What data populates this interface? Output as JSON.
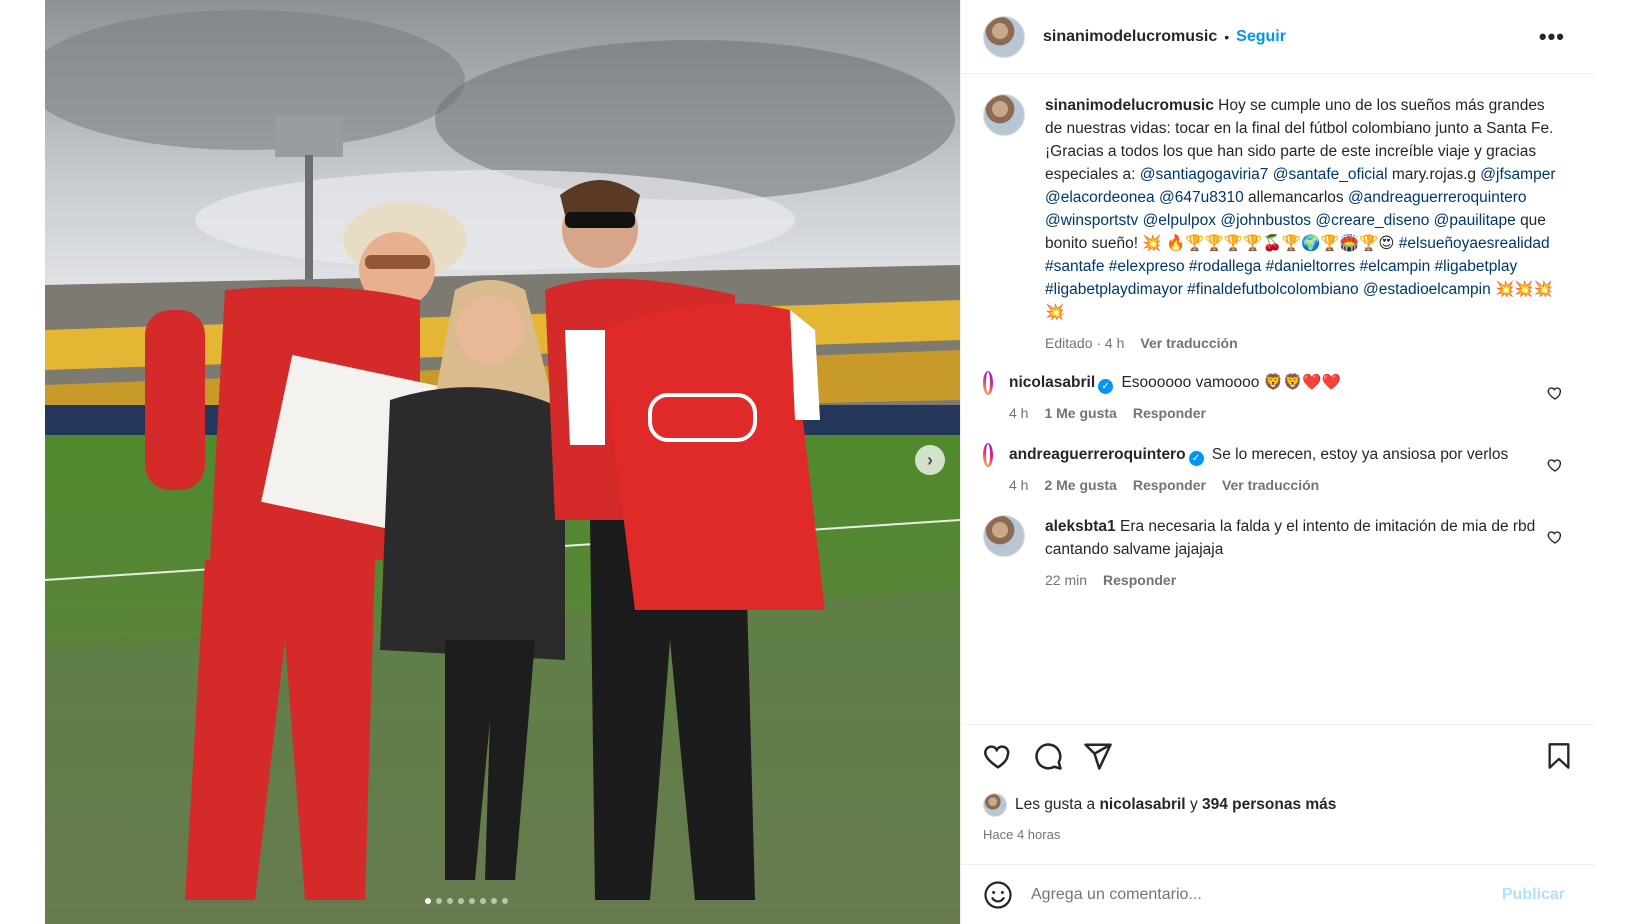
{
  "post": {
    "carousel_dots": 8,
    "active_dot": 0
  },
  "header": {
    "username": "sinanimodelucromusic",
    "separator": "•",
    "follow_label": "Seguir",
    "more_label": "•••"
  },
  "caption": {
    "username": "sinanimodelucromusic",
    "text_1": "Hoy se cumple uno de los sueños más grandes de nuestras vidas: tocar en la final del fútbol colombiano junto a Santa Fe. ¡Gracias a todos los que han sido parte de este increíble viaje y gracias especiales a:",
    "mentions": [
      {
        "t": "@santiagogaviria7",
        "link": true
      },
      {
        "t": "@santafe_oficial",
        "link": true
      },
      {
        "t": "mary.rojas.g",
        "link": false
      },
      {
        "t": "@jfsamper",
        "link": true
      },
      {
        "t": "@elacordeonea",
        "link": true
      },
      {
        "t": "@647u8310",
        "link": true
      },
      {
        "t": "allemancarlos",
        "link": false
      },
      {
        "t": "@andreaguerreroquintero",
        "link": true
      },
      {
        "t": "@winsportstv",
        "link": true
      },
      {
        "t": "@elpulpox",
        "link": true
      },
      {
        "t": "@johnbustos",
        "link": true
      },
      {
        "t": "@creare_diseno",
        "link": true
      },
      {
        "t": "@pauilitape",
        "link": true
      }
    ],
    "text_2": "que bonito sueño! 💥",
    "emojis": "🔥🏆🏆🏆🏆🍒🏆🌍🏆🏟️🏆😍",
    "hashtags": [
      "#elsueñoyaesrealidad",
      "#santafe",
      "#elexpreso",
      "#rodallega",
      "#danieltorres",
      "#elcampin",
      "#ligabetplay",
      "#ligabetplaydimayor",
      "#finaldefutbolcolombiano"
    ],
    "last_mention": "@estadioelcampin",
    "end_emojis": "💥💥💥💥",
    "edited": "Editado · 4 h",
    "translate": "Ver traducción"
  },
  "comments": [
    {
      "username": "nicolasabril",
      "verified": true,
      "text": "Esoooooo vamoooo 🦁🦁❤️❤️",
      "time": "4 h",
      "likes": "1 Me gusta",
      "reply": "Responder",
      "translate": ""
    },
    {
      "username": "andreaguerreroquintero",
      "verified": true,
      "text": "Se lo merecen, estoy ya ansiosa por verlos",
      "time": "4 h",
      "likes": "2 Me gusta",
      "reply": "Responder",
      "translate": "Ver traducción"
    },
    {
      "username": "aleksbta1",
      "verified": false,
      "text": "Era necesaria la falda y el intento de imitación de mia de rbd cantando salvame jajajaja",
      "time": "22 min",
      "likes": "",
      "reply": "Responder",
      "translate": ""
    }
  ],
  "likes_line": {
    "prefix": "Les gusta a",
    "user": "nicolasabril",
    "connector": "y",
    "rest": "394 personas más"
  },
  "posted": "Hace 4 horas",
  "add_comment": {
    "placeholder": "Agrega un comentario...",
    "post_label": "Publicar"
  },
  "colors": {
    "link": "#00376b",
    "follow": "#0095f6",
    "publish_disabled": "#b2dffc"
  },
  "icons": [
    "heart-icon",
    "comment-icon",
    "share-icon",
    "save-icon",
    "emoji-icon",
    "more-icon",
    "verified-icon",
    "next-arrow-icon"
  ]
}
